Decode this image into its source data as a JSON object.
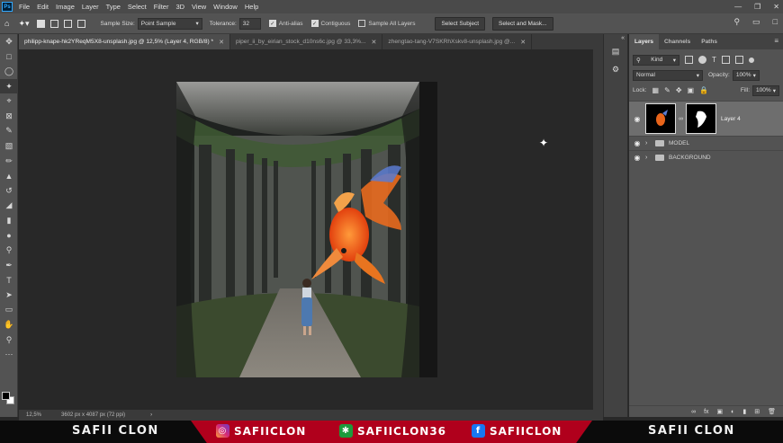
{
  "menubar": {
    "logo": "Ps",
    "items": [
      "File",
      "Edit",
      "Image",
      "Layer",
      "Type",
      "Select",
      "Filter",
      "3D",
      "View",
      "Window",
      "Help"
    ]
  },
  "options": {
    "sample_size_label": "Sample Size:",
    "sample_size_value": "Point Sample",
    "tolerance_label": "Tolerance:",
    "tolerance_value": "32",
    "anti_alias": "Anti-alias",
    "contiguous": "Contiguous",
    "sample_all_layers": "Sample All Layers",
    "select_subject": "Select Subject",
    "select_and_mask": "Select and Mask..."
  },
  "tabs": [
    {
      "label": "philipp-knape-hk2YReqM5X8-unsplash.jpg @ 12,5% (Layer 4, RGB/8) *"
    },
    {
      "label": "piper_ii_by_eirian_stock_d10ns6c.jpg @ 33,3%..."
    },
    {
      "label": "zhengtao-tang-V7SKRhXskv8-unsplash.jpg @..."
    }
  ],
  "status": {
    "zoom": "12,5%",
    "doc_size": "3602 px x 4087 px (72 ppi)"
  },
  "layers": {
    "tabs": [
      "Layers",
      "Channels",
      "Paths"
    ],
    "kind": "Kind",
    "blend_mode": "Normal",
    "opacity_label": "Opacity:",
    "opacity_value": "100%",
    "lock_label": "Lock:",
    "fill_label": "Fill:",
    "fill_value": "100%",
    "items": [
      {
        "name": "Layer 4"
      },
      {
        "name": "MODEL"
      },
      {
        "name": "BACKGROUND"
      }
    ]
  },
  "banner": {
    "left_name": "SAFII CLON",
    "instagram": "SAFIICLON",
    "other": "SAFIICLON36",
    "facebook": "SAFIICLON",
    "right_name": "SAFII CLON",
    "accent": "#b0001c"
  }
}
